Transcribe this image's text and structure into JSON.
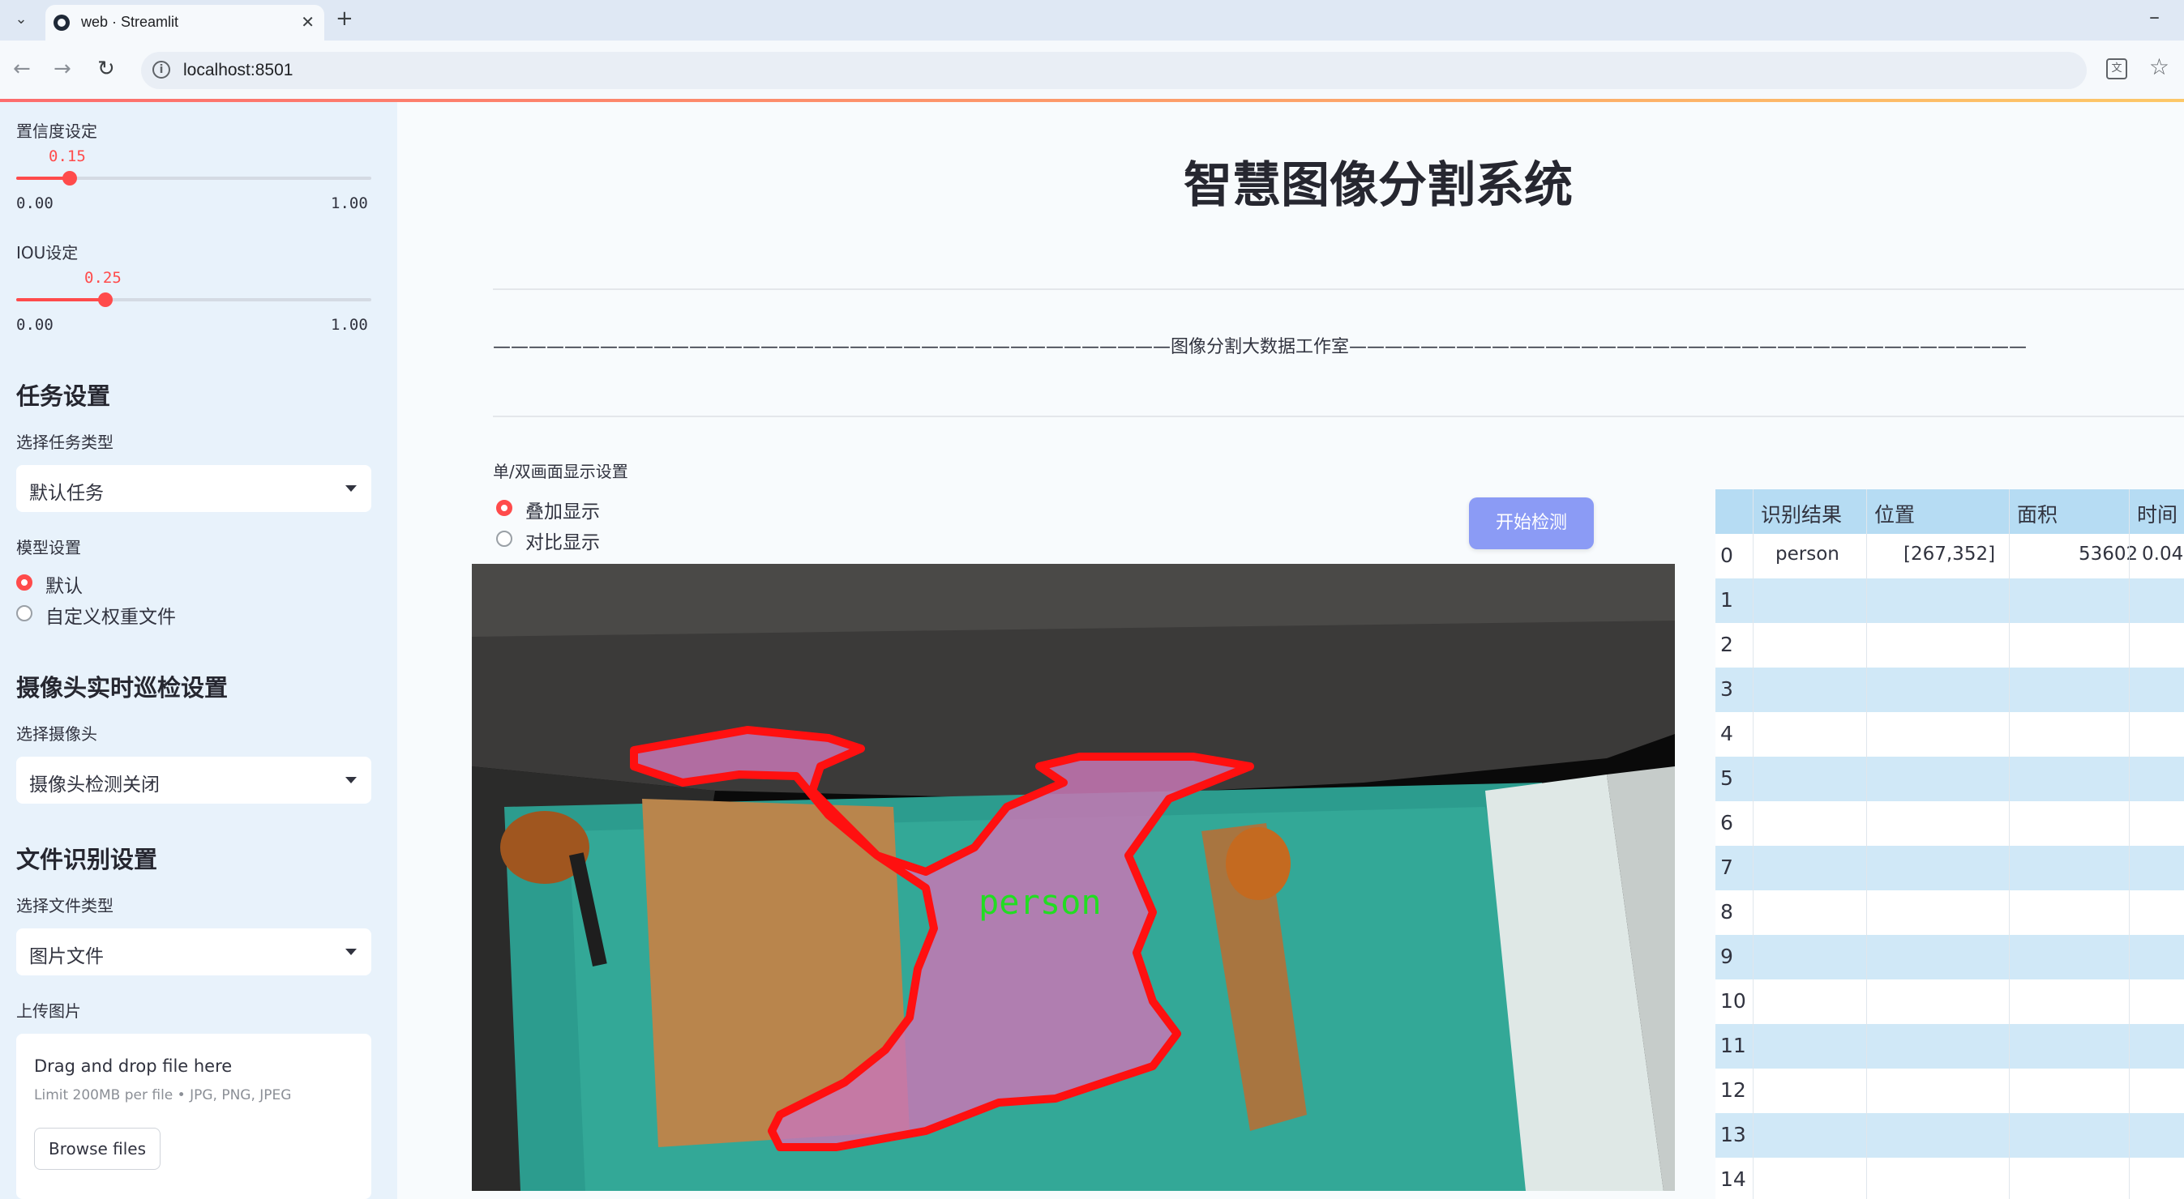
{
  "browser": {
    "tab_title": "web · Streamlit",
    "url": "localhost:8501"
  },
  "sidebar": {
    "confidence": {
      "label": "置信度设定",
      "value": "0.15",
      "min": "0.00",
      "max": "1.00",
      "fraction": 0.15
    },
    "iou": {
      "label": "IOU设定",
      "value": "0.25",
      "min": "0.00",
      "max": "1.00",
      "fraction": 0.25
    },
    "task_section": "任务设置",
    "task_type_label": "选择任务类型",
    "task_type_value": "默认任务",
    "model_label": "模型设置",
    "model_options": [
      "默认",
      "自定义权重文件"
    ],
    "model_selected": 0,
    "camera_section": "摄像头实时巡检设置",
    "camera_label": "选择摄像头",
    "camera_value": "摄像头检测关闭",
    "file_section": "文件识别设置",
    "file_type_label": "选择文件类型",
    "file_type_value": "图片文件",
    "upload_label": "上传图片",
    "upload_title": "Drag and drop file here",
    "upload_limit": "Limit 200MB per file • JPG, PNG, JPEG",
    "browse_button": "Browse files"
  },
  "main": {
    "title": "智慧图像分割系统",
    "subtitle": "——————————————————————————————————————图像分割大数据工作室——————————————————————————————————————",
    "display_mode_label": "单/双画面显示设置",
    "display_options": [
      "叠加显示",
      "对比显示"
    ],
    "display_selected": 0,
    "start_button": "开始检测",
    "detection_label": "person"
  },
  "table": {
    "headers": [
      "",
      "识别结果",
      "位置",
      "面积",
      "时间"
    ],
    "rows": [
      [
        "0",
        "person",
        "[267,352]",
        "53602",
        "0.04"
      ],
      [
        "1",
        "",
        "",
        "",
        ""
      ],
      [
        "2",
        "",
        "",
        "",
        ""
      ],
      [
        "3",
        "",
        "",
        "",
        ""
      ],
      [
        "4",
        "",
        "",
        "",
        ""
      ],
      [
        "5",
        "",
        "",
        "",
        ""
      ],
      [
        "6",
        "",
        "",
        "",
        ""
      ],
      [
        "7",
        "",
        "",
        "",
        ""
      ],
      [
        "8",
        "",
        "",
        "",
        ""
      ],
      [
        "9",
        "",
        "",
        "",
        ""
      ],
      [
        "10",
        "",
        "",
        "",
        ""
      ],
      [
        "11",
        "",
        "",
        "",
        ""
      ],
      [
        "12",
        "",
        "",
        "",
        ""
      ],
      [
        "13",
        "",
        "",
        "",
        ""
      ],
      [
        "14",
        "",
        "",
        "",
        ""
      ]
    ]
  },
  "colors": {
    "accent": "#ff4b4b",
    "button": "#8b9bf5",
    "sidebar_bg": "#e8f2fb",
    "table_header": "#b6dcf3",
    "mask_outline": "#ff1010",
    "label_text": "#22dd22"
  }
}
